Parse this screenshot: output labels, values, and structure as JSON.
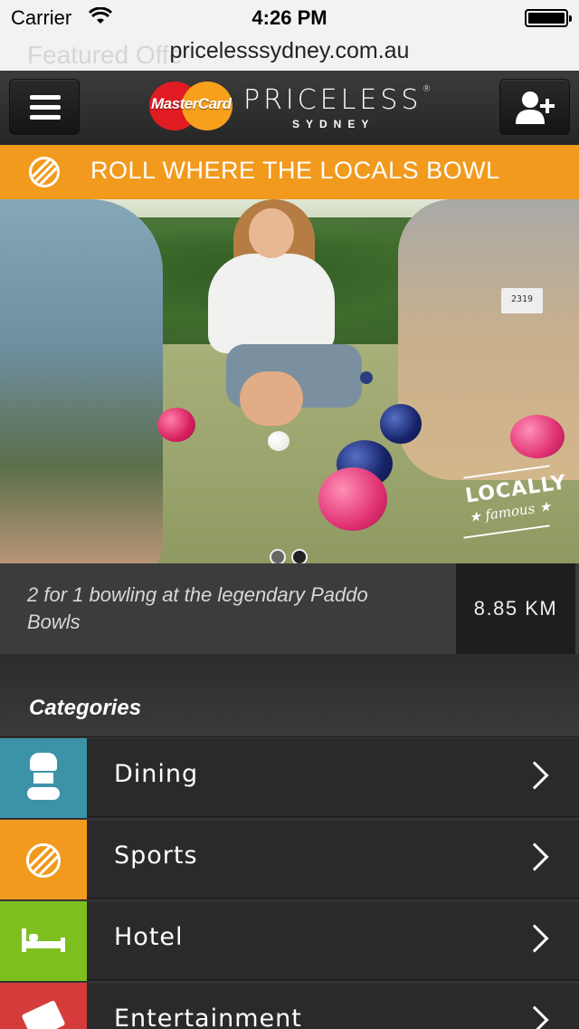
{
  "status_bar": {
    "carrier": "Carrier",
    "time": "4:26 PM"
  },
  "browser": {
    "url": "pricelesssydney.com.au",
    "faded_text": "Featured Offe"
  },
  "header": {
    "mastercard_text": "MasterCard",
    "brand": "PRICELESS",
    "registered_mark": "®",
    "city": "SYDNEY"
  },
  "banner": {
    "title": "ROLL WHERE THE LOCALS BOWL",
    "icon": "sports-ball-icon",
    "color": "#f29a1d"
  },
  "hero": {
    "scoreboard": "2319",
    "stamp_line1": "LOCALLY",
    "stamp_line2": "★ famous ★",
    "carousel_pages": 2,
    "carousel_active": 2
  },
  "offer": {
    "description": "2 for 1 bowling at the legendary Paddo Bowls",
    "distance": "8.85 KM"
  },
  "categories": {
    "heading": "Categories",
    "items": [
      {
        "label": "Dining",
        "icon": "chef-hat-icon",
        "color": "#3c93a8"
      },
      {
        "label": "Sports",
        "icon": "sports-ball-icon",
        "color": "#f29a1d"
      },
      {
        "label": "Hotel",
        "icon": "bed-icon",
        "color": "#7cbf1f"
      },
      {
        "label": "Entertainment",
        "icon": "ticket-icon",
        "color": "#d53b3b"
      }
    ]
  }
}
